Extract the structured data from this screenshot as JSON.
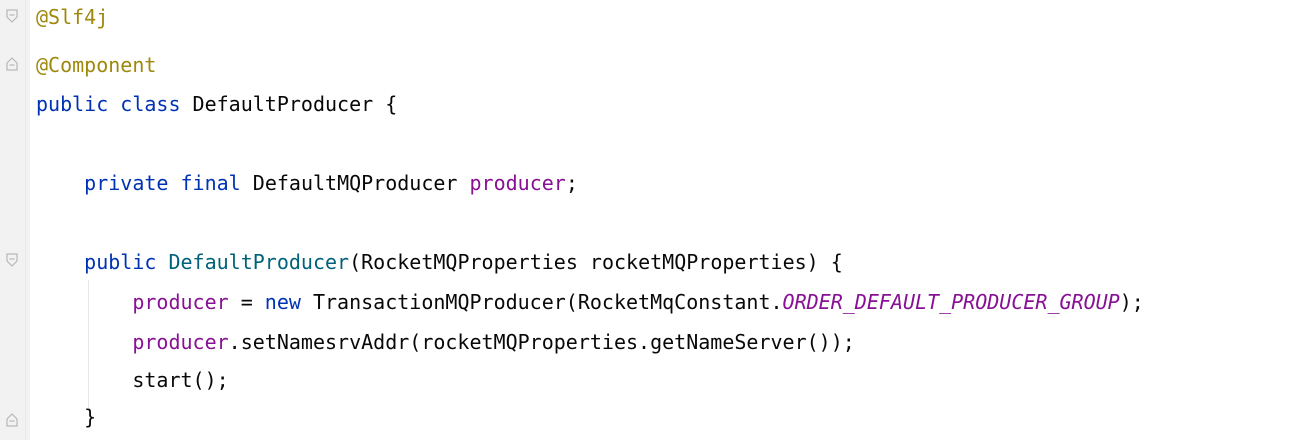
{
  "lines": [
    [
      {
        "t": "@Slf4j",
        "c": "ann"
      }
    ],
    [
      {
        "t": "@Component",
        "c": "ann"
      }
    ],
    [
      {
        "t": "public",
        "c": "kw"
      },
      {
        "t": " ",
        "c": "plain"
      },
      {
        "t": "class",
        "c": "kw"
      },
      {
        "t": " DefaultProducer {",
        "c": "plain"
      }
    ],
    [],
    [
      {
        "t": "    ",
        "c": "plain"
      },
      {
        "t": "private",
        "c": "kw"
      },
      {
        "t": " ",
        "c": "plain"
      },
      {
        "t": "final",
        "c": "kw"
      },
      {
        "t": " DefaultMQProducer ",
        "c": "plain"
      },
      {
        "t": "producer",
        "c": "field"
      },
      {
        "t": ";",
        "c": "plain"
      }
    ],
    [],
    [
      {
        "t": "    ",
        "c": "plain"
      },
      {
        "t": "public",
        "c": "kw"
      },
      {
        "t": " ",
        "c": "plain"
      },
      {
        "t": "DefaultProducer",
        "c": "method"
      },
      {
        "t": "(RocketMQProperties rocketMQProperties) {",
        "c": "plain"
      }
    ],
    [
      {
        "t": "        ",
        "c": "plain"
      },
      {
        "t": "producer",
        "c": "field"
      },
      {
        "t": " = ",
        "c": "plain"
      },
      {
        "t": "new",
        "c": "kw"
      },
      {
        "t": " TransactionMQProducer(RocketMqConstant.",
        "c": "plain"
      },
      {
        "t": "ORDER_DEFAULT_PRODUCER_GROUP",
        "c": "const"
      },
      {
        "t": ");",
        "c": "plain"
      }
    ],
    [
      {
        "t": "        ",
        "c": "plain"
      },
      {
        "t": "producer",
        "c": "field"
      },
      {
        "t": ".setNamesrvAddr(rocketMQProperties.getNameServer());",
        "c": "plain"
      }
    ],
    [
      {
        "t": "        start();",
        "c": "plain"
      }
    ],
    [
      {
        "t": "    }",
        "c": "plain"
      }
    ]
  ],
  "colors": {
    "annotation": "#9e880d",
    "keyword": "#0033b3",
    "field": "#871094",
    "method": "#00627a",
    "plain": "#080808",
    "background": "#ffffff",
    "gutter": "#f2f2f2"
  },
  "icons": {
    "fold_open": "fold-open-icon",
    "fold_close": "fold-close-icon"
  }
}
